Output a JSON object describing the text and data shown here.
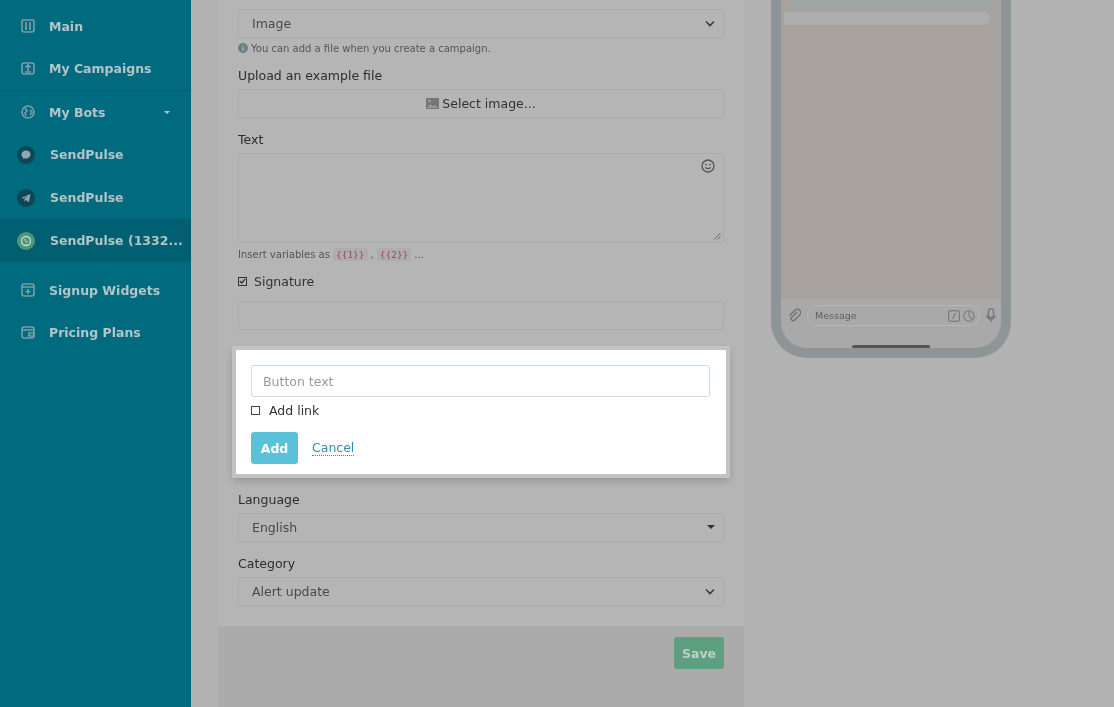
{
  "sidebar": {
    "items": [
      {
        "label": "Main",
        "kind": "section",
        "selected": false
      },
      {
        "label": "My Campaigns",
        "kind": "section",
        "selected": false
      },
      {
        "label": "My Bots",
        "kind": "group",
        "expanded": true,
        "selected": false
      },
      {
        "label": "SendPulse",
        "kind": "bot",
        "color": "#0d4656",
        "selected": false
      },
      {
        "label": "SendPulse",
        "kind": "bot",
        "color": "#0d4656",
        "selected": false
      },
      {
        "label": "SendPulse (1332...",
        "kind": "bot",
        "color": "#4e9777",
        "selected": true
      },
      {
        "label": "Signup Widgets",
        "kind": "section",
        "selected": false
      },
      {
        "label": "Pricing Plans",
        "kind": "section",
        "selected": false
      }
    ]
  },
  "form": {
    "file_type": {
      "value": "Image",
      "hint": "You can add a file when you create a campaign."
    },
    "upload": {
      "label": "Upload an example file",
      "button": "Select image..."
    },
    "text": {
      "label": "Text",
      "hint": [
        {
          "kind": "text",
          "text": "Insert variables as"
        },
        {
          "kind": "code",
          "text": "{{1}}"
        },
        {
          "kind": "text",
          "text": ","
        },
        {
          "kind": "code",
          "text": "{{2}}"
        },
        {
          "kind": "text",
          "text": "..."
        }
      ]
    },
    "signature": {
      "label": "Signature",
      "checked": true
    },
    "button_popup": {
      "placeholder": "Button text",
      "add_link": {
        "label": "Add link",
        "checked": false
      },
      "add": "Add",
      "cancel": "Cancel"
    },
    "language": {
      "label": "Language",
      "value": "English"
    },
    "category": {
      "label": "Category",
      "value": "Alert update"
    },
    "save": "Save"
  },
  "phone_preview": {
    "message_placeholder": "Message"
  }
}
